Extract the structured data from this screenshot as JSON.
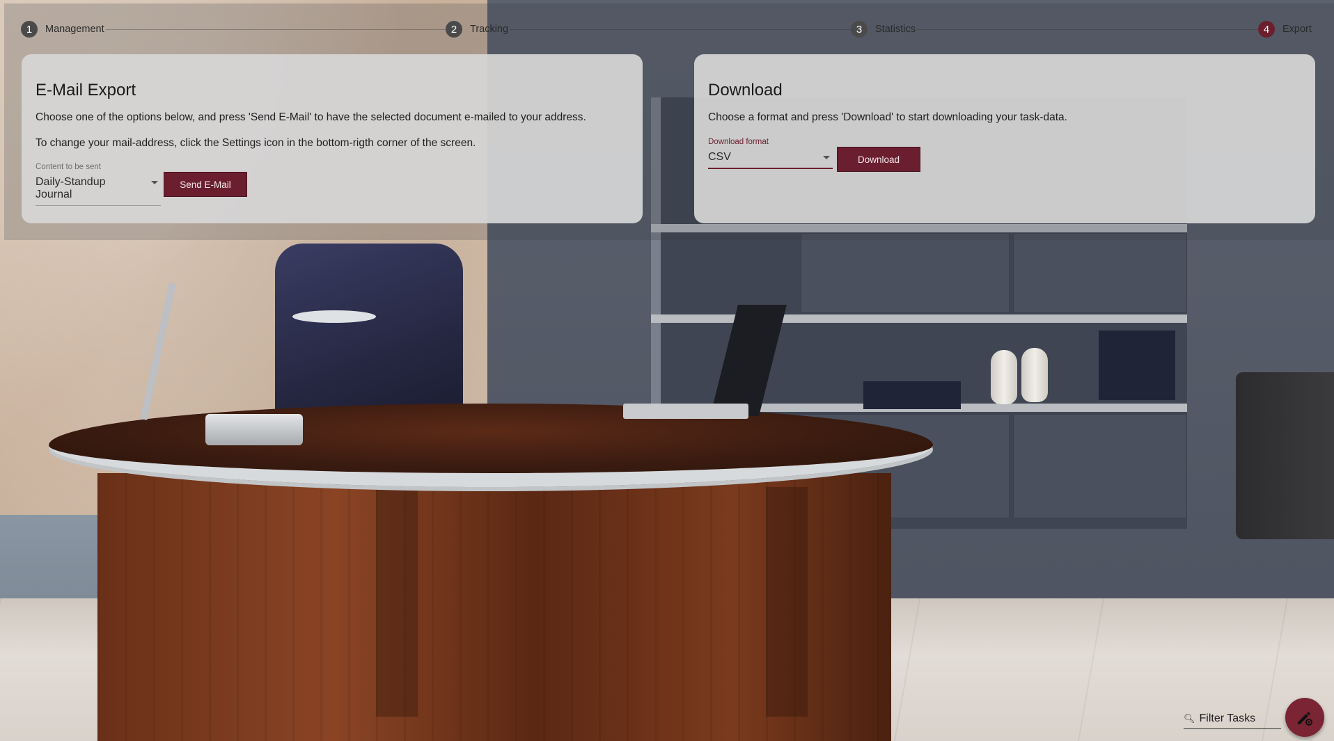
{
  "stepper": {
    "steps": [
      {
        "number": "1",
        "label": "Management"
      },
      {
        "number": "2",
        "label": "Tracking"
      },
      {
        "number": "3",
        "label": "Statistics"
      },
      {
        "number": "4",
        "label": "Export"
      }
    ],
    "active_step": "4"
  },
  "email_export": {
    "title": "E-Mail Export",
    "text1": "Choose one of the options below, and press 'Send E-Mail' to have the selected document e-mailed to your address.",
    "text2": "To change your mail-address, click the Settings icon in the bottom-rigth corner of the screen.",
    "content_label": "Content to be sent",
    "content_value": "Daily-Standup Journal",
    "send_button": "Send E-Mail"
  },
  "download": {
    "title": "Download",
    "text": "Choose a format and press 'Download' to start downloading your task-data.",
    "format_label": "Download format",
    "format_value": "CSV",
    "download_button": "Download"
  },
  "filter": {
    "placeholder": "Filter Tasks"
  },
  "colors": {
    "accent": "#6b1f2e",
    "card_bg": "#d6d6d6",
    "fab": "#7a2434"
  },
  "icons": {
    "filter": "search-icon",
    "fab": "edit-settings-icon"
  }
}
